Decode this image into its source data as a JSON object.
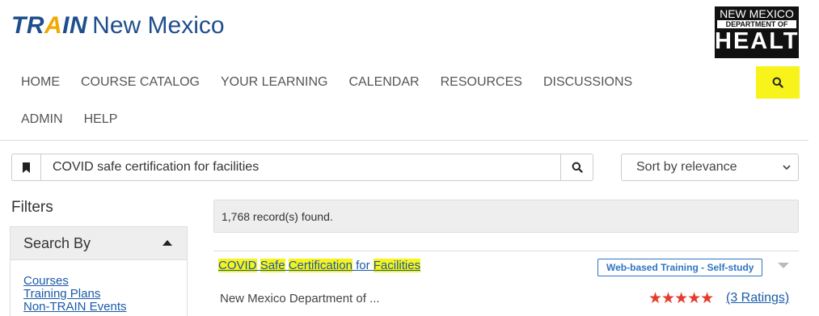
{
  "header": {
    "brand_prefix": "TR",
    "brand_accent": "A",
    "brand_suffix": "IN",
    "region": "New Mexico",
    "doh_logo": {
      "line1": "NEW MEXICO",
      "line2": "DEPARTMENT OF",
      "line3": "HEALTH"
    }
  },
  "nav": {
    "items": [
      "HOME",
      "COURSE CATALOG",
      "YOUR LEARNING",
      "CALENDAR",
      "RESOURCES",
      "DISCUSSIONS",
      "ADMIN",
      "HELP"
    ],
    "search_icon": "search-icon",
    "search_highlight_color": "#f7f31b"
  },
  "search": {
    "value": "COVID safe certification for facilities",
    "bookmark_icon": "bookmark-icon",
    "button_icon": "search-icon"
  },
  "sort": {
    "selected": "Sort by relevance"
  },
  "filters": {
    "title": "Filters",
    "section_label": "Search By",
    "links": [
      "Courses",
      "Training Plans",
      "Non-TRAIN Events"
    ]
  },
  "results": {
    "count_text": "1,768 record(s) found.",
    "items": [
      {
        "title_parts": [
          {
            "text": "COVID",
            "hl": true
          },
          {
            "text": " ",
            "hl": false
          },
          {
            "text": "Safe",
            "hl": true
          },
          {
            "text": " ",
            "hl": false
          },
          {
            "text": "Certification",
            "hl": true
          },
          {
            "text": " for ",
            "hl": false
          },
          {
            "text": "Facilities",
            "hl": true
          }
        ],
        "badge": "Web-based Training - Self-study",
        "provider": "New Mexico Department of ...",
        "stars": "★★★★★",
        "rating_value": 5,
        "ratings_text": "(3 Ratings)"
      }
    ]
  },
  "colors": {
    "brand": "#1f4e8c",
    "accent": "#f2a900",
    "link": "#1a5aa8",
    "stars": "#e53b2c",
    "highlight": "#f7f31b"
  }
}
